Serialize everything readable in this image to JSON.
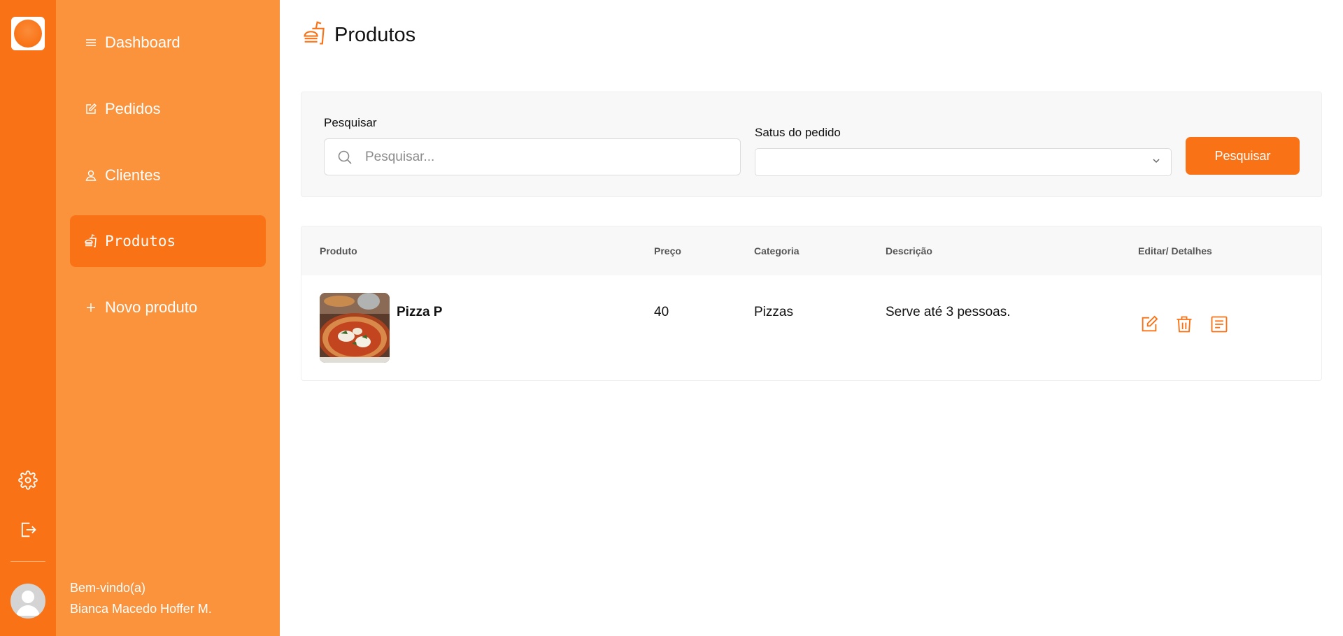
{
  "sidebar": {
    "items": [
      {
        "label": "Dashboard",
        "icon": "menu-icon"
      },
      {
        "label": "Pedidos",
        "icon": "edit-icon"
      },
      {
        "label": "Clientes",
        "icon": "user-icon"
      },
      {
        "label": "Produtos",
        "icon": "fastfood-icon",
        "active": true
      },
      {
        "label": "Novo produto",
        "icon": "plus-icon"
      }
    ],
    "welcome": "Bem-vindo(a)",
    "user_name": "Bianca Macedo Hoffer M."
  },
  "rail": {
    "icons": [
      "logo",
      "settings-icon",
      "logout-icon",
      "avatar"
    ]
  },
  "page": {
    "title": "Produtos"
  },
  "filters": {
    "search_label": "Pesquisar",
    "search_placeholder": "Pesquisar...",
    "status_label": "Satus do pedido",
    "status_value": "",
    "button_label": "Pesquisar"
  },
  "table": {
    "headers": [
      "Produto",
      "Preço",
      "Categoria",
      "Descrição",
      "Editar/ Detalhes"
    ],
    "rows": [
      {
        "product": "Pizza P",
        "price": "40",
        "category": "Pizzas",
        "description": "Serve até 3 pessoas."
      }
    ]
  },
  "colors": {
    "accent": "#f97316",
    "sidebar": "#fb923c",
    "rail": "#f97316"
  }
}
